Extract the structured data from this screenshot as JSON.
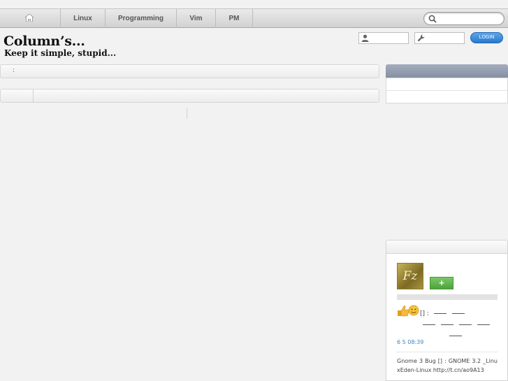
{
  "nav": {
    "items": [
      "Linux",
      "Programming",
      "Vim",
      "PM"
    ]
  },
  "header": {
    "title": "Column’s...",
    "tagline": "Keep it simple, stupid..."
  },
  "login": {
    "button_label": "LOGIN"
  },
  "main": {
    "bar1_text": ":"
  },
  "weibo": {
    "avatar_text": "Fz",
    "follow_label": "+",
    "post_meta_text": "[]   :",
    "post_time": "6 5  08:39",
    "post_text": "Gnome 3 Bug [] : GNOME 3.2 _LinuxEden-Linux http://t.cn/ao9A13"
  },
  "colors": {
    "accent": "#2b78cc",
    "follow": "#4ea23b",
    "link": "#3a84c6"
  }
}
